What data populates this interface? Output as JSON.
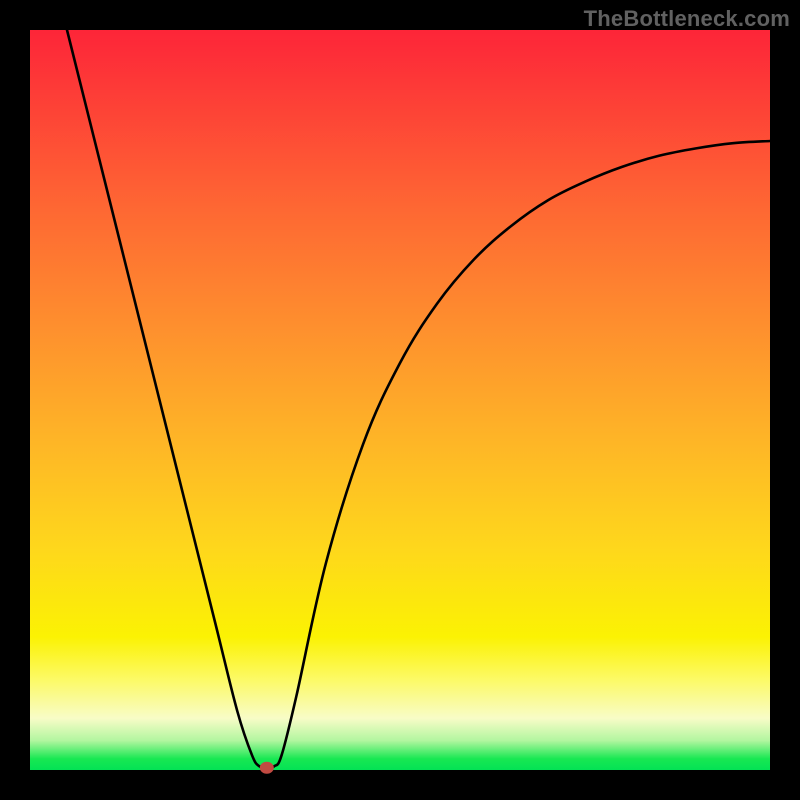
{
  "attribution": "TheBottleneck.com",
  "colors": {
    "frame": "#000000",
    "gradient_top": "#fd2538",
    "gradient_mid1": "#fe8f2e",
    "gradient_mid2": "#fed71c",
    "gradient_mid3": "#fbf203",
    "gradient_bottom": "#03e255",
    "curve": "#000000",
    "marker": "#c14a42"
  },
  "chart_data": {
    "type": "line",
    "title": "",
    "xlabel": "",
    "ylabel": "",
    "xlim": [
      0,
      100
    ],
    "ylim": [
      0,
      100
    ],
    "grid": false,
    "legend": false,
    "series": [
      {
        "name": "bottleneck-curve",
        "x": [
          5,
          10,
          15,
          20,
          25,
          28,
          30,
          31,
          32,
          33,
          34,
          36,
          40,
          45,
          50,
          55,
          60,
          65,
          70,
          75,
          80,
          85,
          90,
          95,
          100
        ],
        "values": [
          100,
          80,
          60,
          40,
          20,
          8,
          2,
          0.5,
          0.3,
          0.5,
          2,
          10,
          28,
          44,
          55,
          63,
          69,
          73.5,
          77,
          79.5,
          81.5,
          83,
          84,
          84.7,
          85
        ]
      }
    ],
    "marker": {
      "x": 32,
      "y": 0.3
    },
    "notes": "x and y are in percent of the visible plot area; (0,0) is bottom-left, (100,100) is top-left of the gradient. Curve values estimated from pixel positions since no axes or ticks are rendered."
  }
}
